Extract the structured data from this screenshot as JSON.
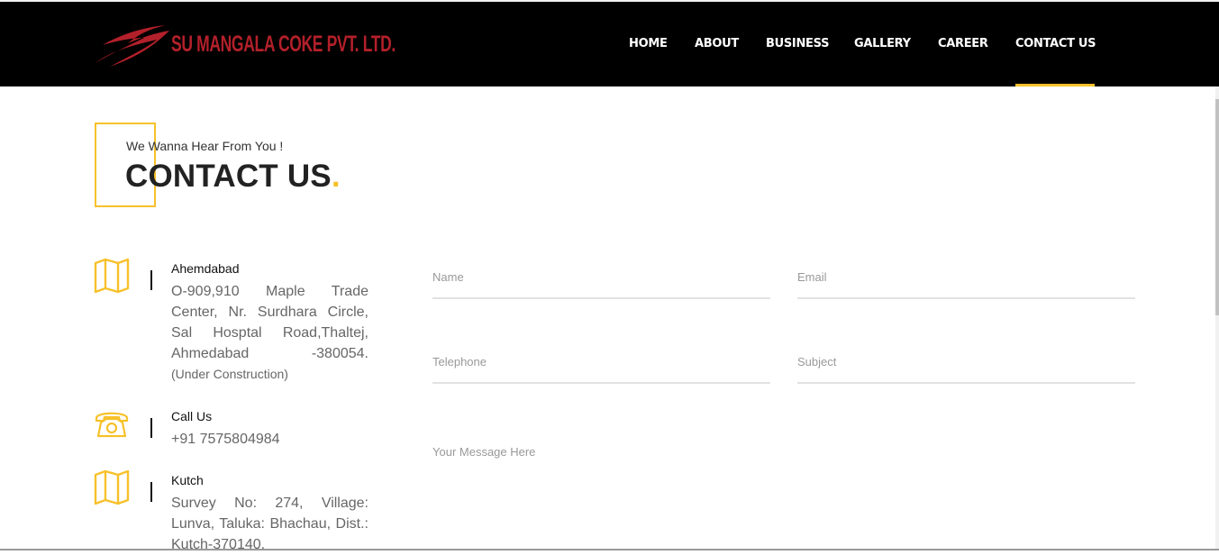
{
  "brand": {
    "name": "SU MANGALA COKE PVT. LTD.",
    "logo_icon": "swoosh-logo-icon",
    "color": "#b3202a"
  },
  "nav": {
    "items": [
      {
        "label": "HOME"
      },
      {
        "label": "ABOUT"
      },
      {
        "label": "BUSINESS"
      },
      {
        "label": "GALLERY"
      },
      {
        "label": "CAREER"
      },
      {
        "label": "CONTACT US"
      }
    ],
    "active": "CONTACT US"
  },
  "section": {
    "subtitle": "We Wanna Hear From You !",
    "title": "CONTACT US",
    "title_dot": "."
  },
  "contacts": [
    {
      "icon": "map-icon",
      "label": "Ahemdabad",
      "text": "O-909,910 Maple Trade Center, Nr. Surdhara Circle, Sal Hosptal Road,Thaltej, Ahmedabad -380054.",
      "note": "(Under Construction)"
    },
    {
      "icon": "phone-icon",
      "label": "Call Us",
      "text": "+91 7575804984"
    },
    {
      "icon": "map-icon",
      "label": "Kutch",
      "text": "Survey No: 274, Village: Lunva, Taluka: Bhachau, Dist.: Kutch-370140."
    }
  ],
  "form": {
    "name_placeholder": "Name",
    "email_placeholder": "Email",
    "telephone_placeholder": "Telephone",
    "subject_placeholder": "Subject",
    "message_placeholder": "Your Message Here"
  },
  "colors": {
    "accent": "#f7c12b",
    "header_bg": "#000000",
    "text_muted": "#666666"
  }
}
